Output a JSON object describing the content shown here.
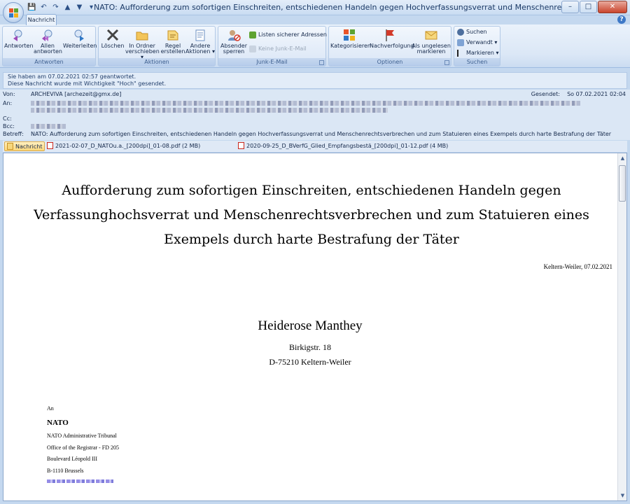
{
  "window": {
    "title": "NATO: Aufforderung zum sofortigen Einschreiten, entschiedenen Handeln gegen Hochverfassungsverrat und Menschenrechtsverbrechen und zum Statuieren eines Exempels durch h...",
    "controls": {
      "minimize": "–",
      "maximize": "□",
      "close": "✕"
    }
  },
  "ribbon": {
    "tab": "Nachricht",
    "groups": {
      "antworten": {
        "label": "Antworten",
        "reply": "Antworten",
        "reply_all_1": "Allen",
        "reply_all_2": "antworten",
        "forward": "Weiterleiten"
      },
      "aktionen": {
        "label": "Aktionen",
        "delete": "Löschen",
        "move_1": "In Ordner",
        "move_2": "verschieben ▾",
        "rule_1": "Regel",
        "rule_2": "erstellen",
        "other_1": "Andere",
        "other_2": "Aktionen ▾"
      },
      "junk": {
        "label": "Junk-E-Mail",
        "block_1": "Absender",
        "block_2": "sperren",
        "safe_list": "Listen sicherer Adressen ▾",
        "not_junk": "Keine Junk-E-Mail"
      },
      "optionen": {
        "label": "Optionen",
        "categorize": "Kategorisieren",
        "followup": "Nachverfolgung",
        "unread_1": "Als ungelesen",
        "unread_2": "markieren"
      },
      "suchen": {
        "label": "Suchen",
        "find": "Suchen",
        "related": "Verwandt ▾",
        "select": "Markieren ▾"
      }
    }
  },
  "infobar": {
    "line1": "Sie haben am 07.02.2021 02:57 geantwortet.",
    "line2": "Diese Nachricht wurde mit Wichtigkeit \"Hoch\" gesendet."
  },
  "header": {
    "from_label": "Von:",
    "from_value": "ARCHEVIVA [archezeit@gmx.de]",
    "to_label": "An:",
    "cc_label": "Cc:",
    "bcc_label": "Bcc:",
    "subject_label": "Betreff:",
    "subject_value": "NATO: Aufforderung zum sofortigen Einschreiten, entschiedenen Handeln gegen Hochverfassungsverrat und Menschenrechtsverbrechen und zum Statuieren eines Exempels durch harte Bestrafung der Täter",
    "sent_label": "Gesendet:",
    "sent_value": "So 07.02.2021 02:04"
  },
  "attachments": [
    {
      "name": "Nachricht",
      "icon": "envelope-icon"
    },
    {
      "name": "2021-02-07_D_NATOu.a._[200dpi]_01-08.pdf (2 MB)",
      "icon": "pdf-icon"
    },
    {
      "name": "2020-09-25_D_BVerfG_Glied_Empfangsbestä_[200dpi]_01-12.pdf (4 MB)",
      "icon": "pdf-icon"
    }
  ],
  "letter": {
    "title_line1": "Aufforderung zum sofortigen Einschreiten, entschiedenen Handeln gegen",
    "title_line2": "Verfassunghochsverrat und Menschenrechtsverbrechen und zum Statuieren eines",
    "title_line3": "Exempels durch harte Bestrafung der Täter",
    "place_date": "Keltern-Weiler, 07.02.2021",
    "sender_name": "Heiderose Manthey",
    "sender_street": "Birkigstr. 18",
    "sender_city": "D-75210 Keltern-Weiler",
    "to_label": "An",
    "recipient_name": "NATO",
    "recipient_line1": "NATO Administrative Tribunal",
    "recipient_line2": "Office of the Registrar - FD 205",
    "recipient_line3": "Boulevard Léopold III",
    "recipient_line4": "B-1110 Brussels"
  },
  "colors": {
    "accent": "#3d78c6",
    "ribbon_bg": "#dbe7f6",
    "selected_attachment": "#ffd87a"
  }
}
